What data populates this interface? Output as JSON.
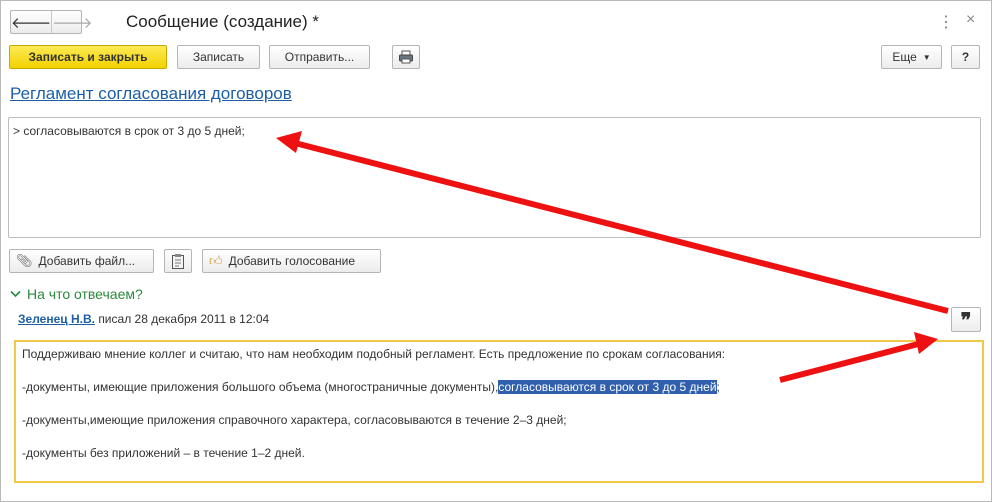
{
  "window": {
    "title": "Сообщение (создание) *"
  },
  "toolbar": {
    "save_close_label": "Записать и закрыть",
    "save_label": "Записать",
    "send_label": "Отправить...",
    "more_label": "Еще",
    "help_label": "?"
  },
  "topic": {
    "link_title": "Регламент согласования договоров"
  },
  "editor": {
    "text": "> согласовываются в срок от 3 до 5 дней;"
  },
  "attachments": {
    "add_file_label": "Добавить файл...",
    "add_vote_label": "Добавить голосование"
  },
  "reply": {
    "toggle_label": "На что отвечаем?",
    "author": "Зеленец Н.В.",
    "meta": "писал 28 декабря 2011 в 12:04",
    "quote_glyph": "❞",
    "paragraph1": "Поддерживаю мнение коллег и считаю, что нам необходим подобный регламент. Есть предложение по срокам согласования:",
    "paragraph2_prefix": "-документы, имеющие приложения большого объема (многостраничные документы),",
    "paragraph2_selected": "согласовываются в срок от 3 до 5 дней",
    "paragraph2_suffix": ";",
    "paragraph3": "-документы,имеющие приложения справочного характера, согласовываются в течение 2–3 дней;",
    "paragraph4": "-документы без приложений – в течение 1–2 дней."
  },
  "icons": {
    "back": "arrow-left-icon",
    "forward": "arrow-right-icon",
    "print": "printer-icon",
    "kebab": "more-vertical-icon",
    "close": "close-icon",
    "attach": "paperclip-icon",
    "clipboard": "clipboard-icon",
    "vote": "thumbs-up-icon",
    "chevron": "chevron-down-icon"
  },
  "colors": {
    "primary_button": "#f2d200",
    "link": "#1d5fa6",
    "toggle_green": "#2a8a3e",
    "quote_border": "#f2c84b",
    "selection": "#2f5fad",
    "annotation_arrow": "#ee1111"
  }
}
